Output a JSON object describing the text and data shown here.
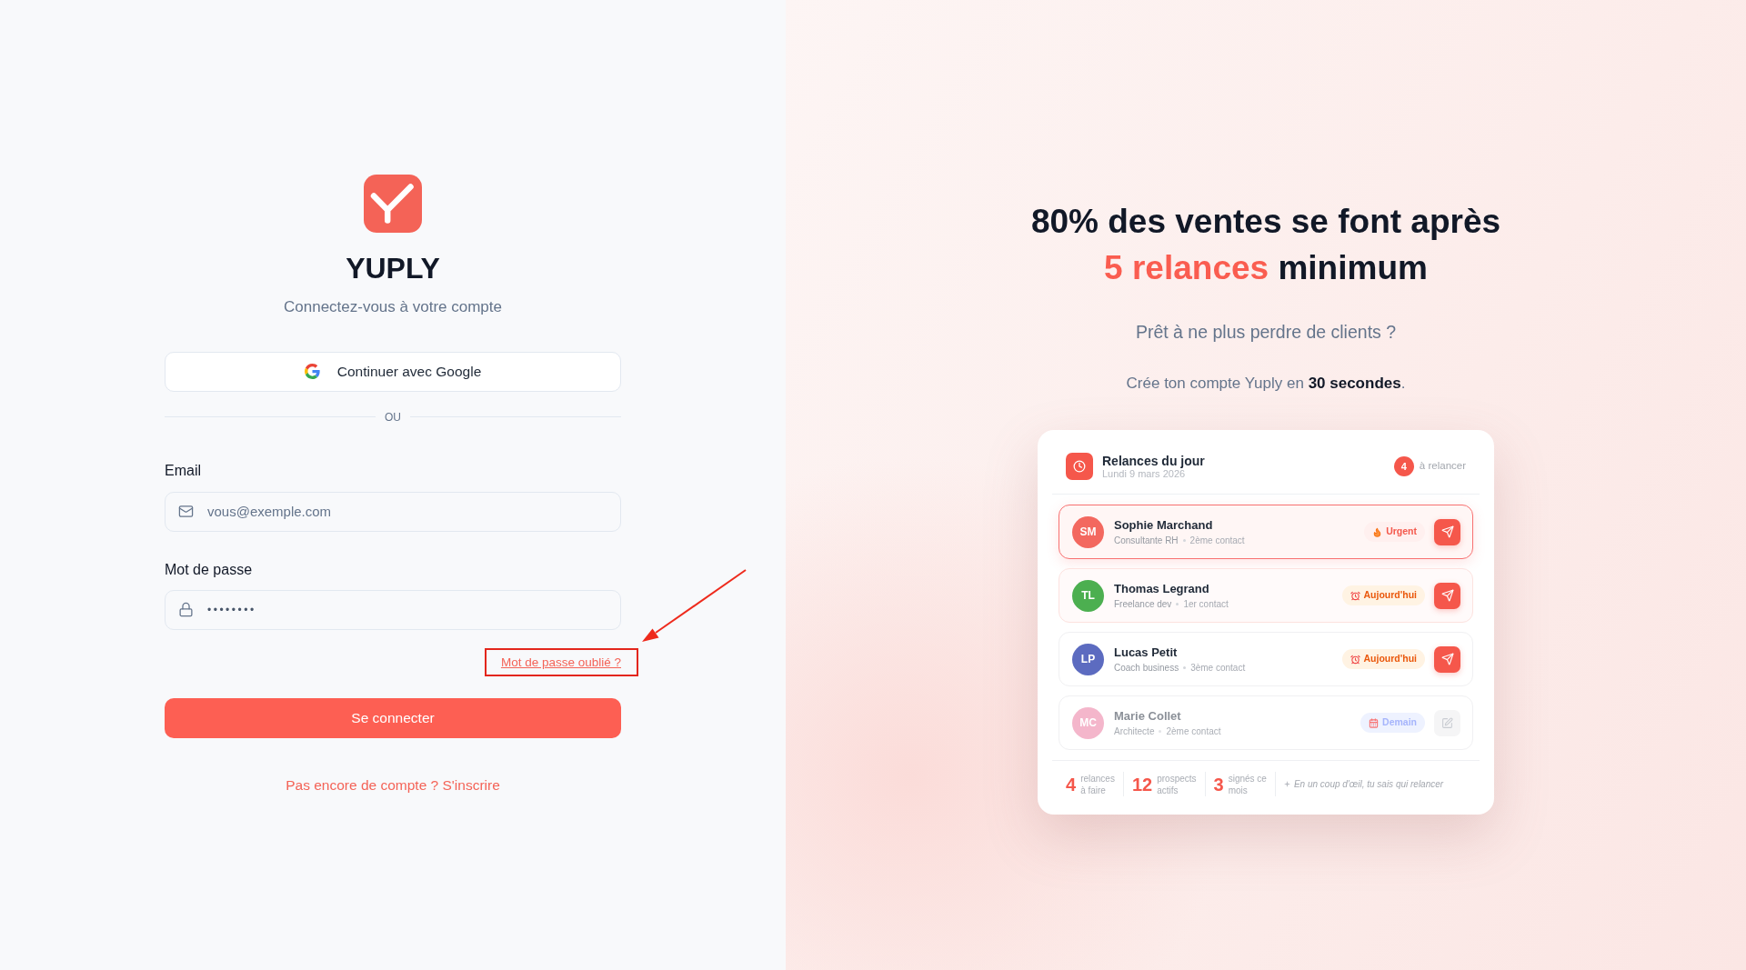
{
  "brand": {
    "name": "YUPLY",
    "subtitle": "Connectez-vous à votre compte"
  },
  "google_button": {
    "label": "Continuer avec Google"
  },
  "divider": {
    "label": "OU"
  },
  "email": {
    "label": "Email",
    "placeholder": "vous@exemple.com"
  },
  "password": {
    "label": "Mot de passe",
    "value": "••••••••"
  },
  "forgot_link": {
    "label": "Mot de passe oublié ?"
  },
  "submit_button": {
    "label": "Se connecter"
  },
  "signup_link": {
    "label": "Pas encore de compte ? S'inscrire"
  },
  "promo": {
    "headline": {
      "line_1": "80% des ventes se font après",
      "highlight": "5 relances",
      "line_2_rest": "minimum"
    },
    "question": "Prêt à ne plus perdre de clients ?",
    "tagline": "Crée ton compte Yuply en **30 secondes**."
  },
  "card": {
    "title": "Relances du jour",
    "date": "Lundi 9 mars 2026",
    "count": "4",
    "count_label": "à relancer",
    "rows": [
      {
        "kind": "send",
        "initials": "SM",
        "color": "#f3685f",
        "name": "Sophie Marchand",
        "role": "Consultante RH",
        "contact": "2ème contact",
        "tag": {
          "kind": "urgent",
          "label": "Urgent"
        },
        "selected": true,
        "hovered": true,
        "faded": false
      },
      {
        "kind": "send",
        "initials": "TL",
        "color": "#4caf50",
        "name": "Thomas Legrand",
        "role": "Freelance dev",
        "contact": "1er contact",
        "tag": {
          "kind": "today",
          "label": "Aujourd'hui"
        },
        "selected": false,
        "hovered": true,
        "faded": false
      },
      {
        "kind": "send",
        "initials": "LP",
        "color": "#5c6bc0",
        "name": "Lucas Petit",
        "role": "Coach business",
        "contact": "3ème contact",
        "tag": {
          "kind": "today",
          "label": "Aujourd'hui"
        },
        "selected": false,
        "hovered": false,
        "faded": false
      },
      {
        "kind": "edit",
        "initials": "MC",
        "color": "#f4b6cb",
        "name": "Marie Collet",
        "role": "Architecte",
        "contact": "2ème contact",
        "tag": {
          "kind": "tomorrow",
          "label": "Demain"
        },
        "selected": false,
        "hovered": false,
        "faded": true
      }
    ],
    "stats": [
      {
        "value": "4",
        "label": "relances\nà faire"
      },
      {
        "value": "12",
        "label": "prospects\nactifs"
      },
      {
        "value": "3",
        "label": "signés ce\nmois"
      }
    ],
    "note": "En un coup d'œil, tu sais qui relancer"
  }
}
